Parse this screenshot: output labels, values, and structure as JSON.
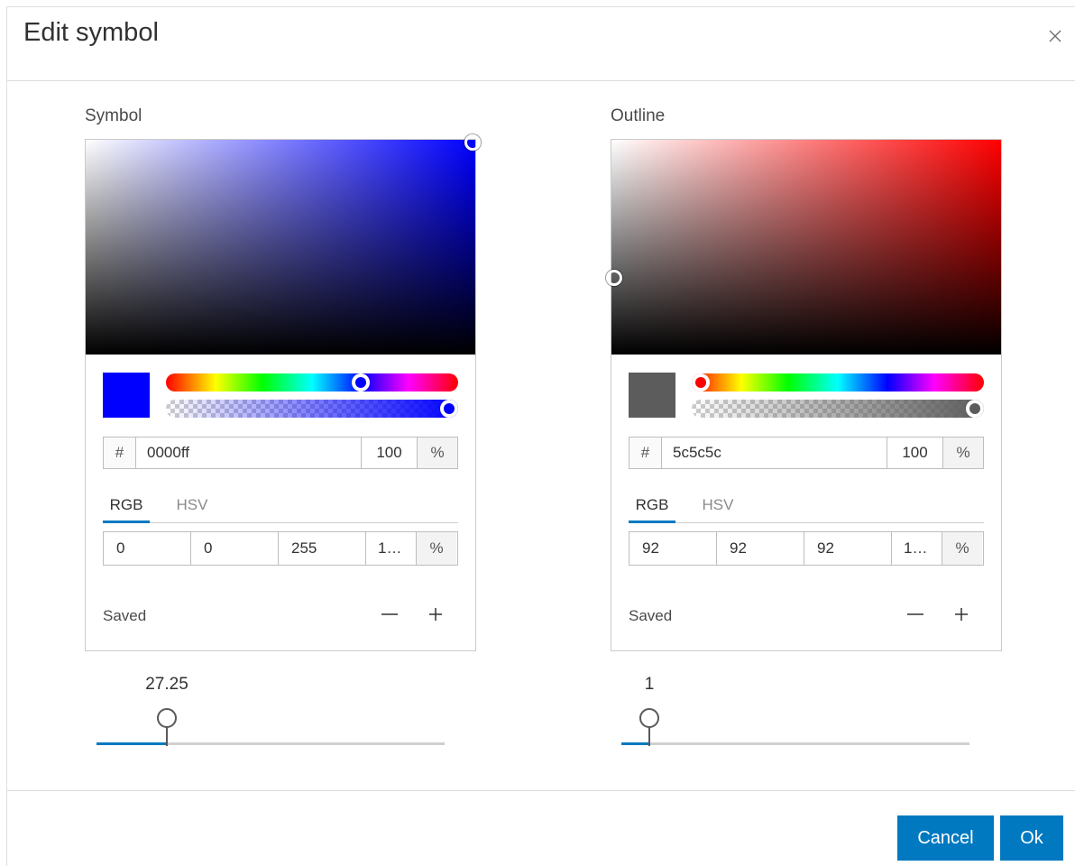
{
  "dialog": {
    "title": "Edit symbol",
    "cancel_label": "Cancel",
    "ok_label": "Ok"
  },
  "symbol": {
    "label": "Symbol",
    "hue_color": "#0000ff",
    "hex_prefix": "#",
    "hex_value": "0000ff",
    "opacity": "100",
    "opacity_unit": "%",
    "tabs": [
      "RGB",
      "HSV"
    ],
    "active_tab": "RGB",
    "r": "0",
    "g": "0",
    "b": "255",
    "a": "1…",
    "a_unit": "%",
    "saved_label": "Saved",
    "hue_position": 0.667,
    "size": "27.25",
    "size_fraction": 0.2
  },
  "outline": {
    "label": "Outline",
    "hue_color": "#ff0000",
    "hex_prefix": "#",
    "hex_value": "5c5c5c",
    "opacity": "100",
    "opacity_unit": "%",
    "tabs": [
      "RGB",
      "HSV"
    ],
    "active_tab": "RGB",
    "r": "92",
    "g": "92",
    "b": "92",
    "a": "1…",
    "a_unit": "%",
    "saved_label": "Saved",
    "hue_position": 0.0,
    "size": "1",
    "size_fraction": 0.08
  },
  "icons": {
    "close": "close-icon",
    "minus": "minus-icon",
    "plus": "plus-icon"
  },
  "colors": {
    "accent": "#0079c1",
    "symbol_preview": "#0000ff",
    "outline_preview": "#5c5c5c"
  }
}
